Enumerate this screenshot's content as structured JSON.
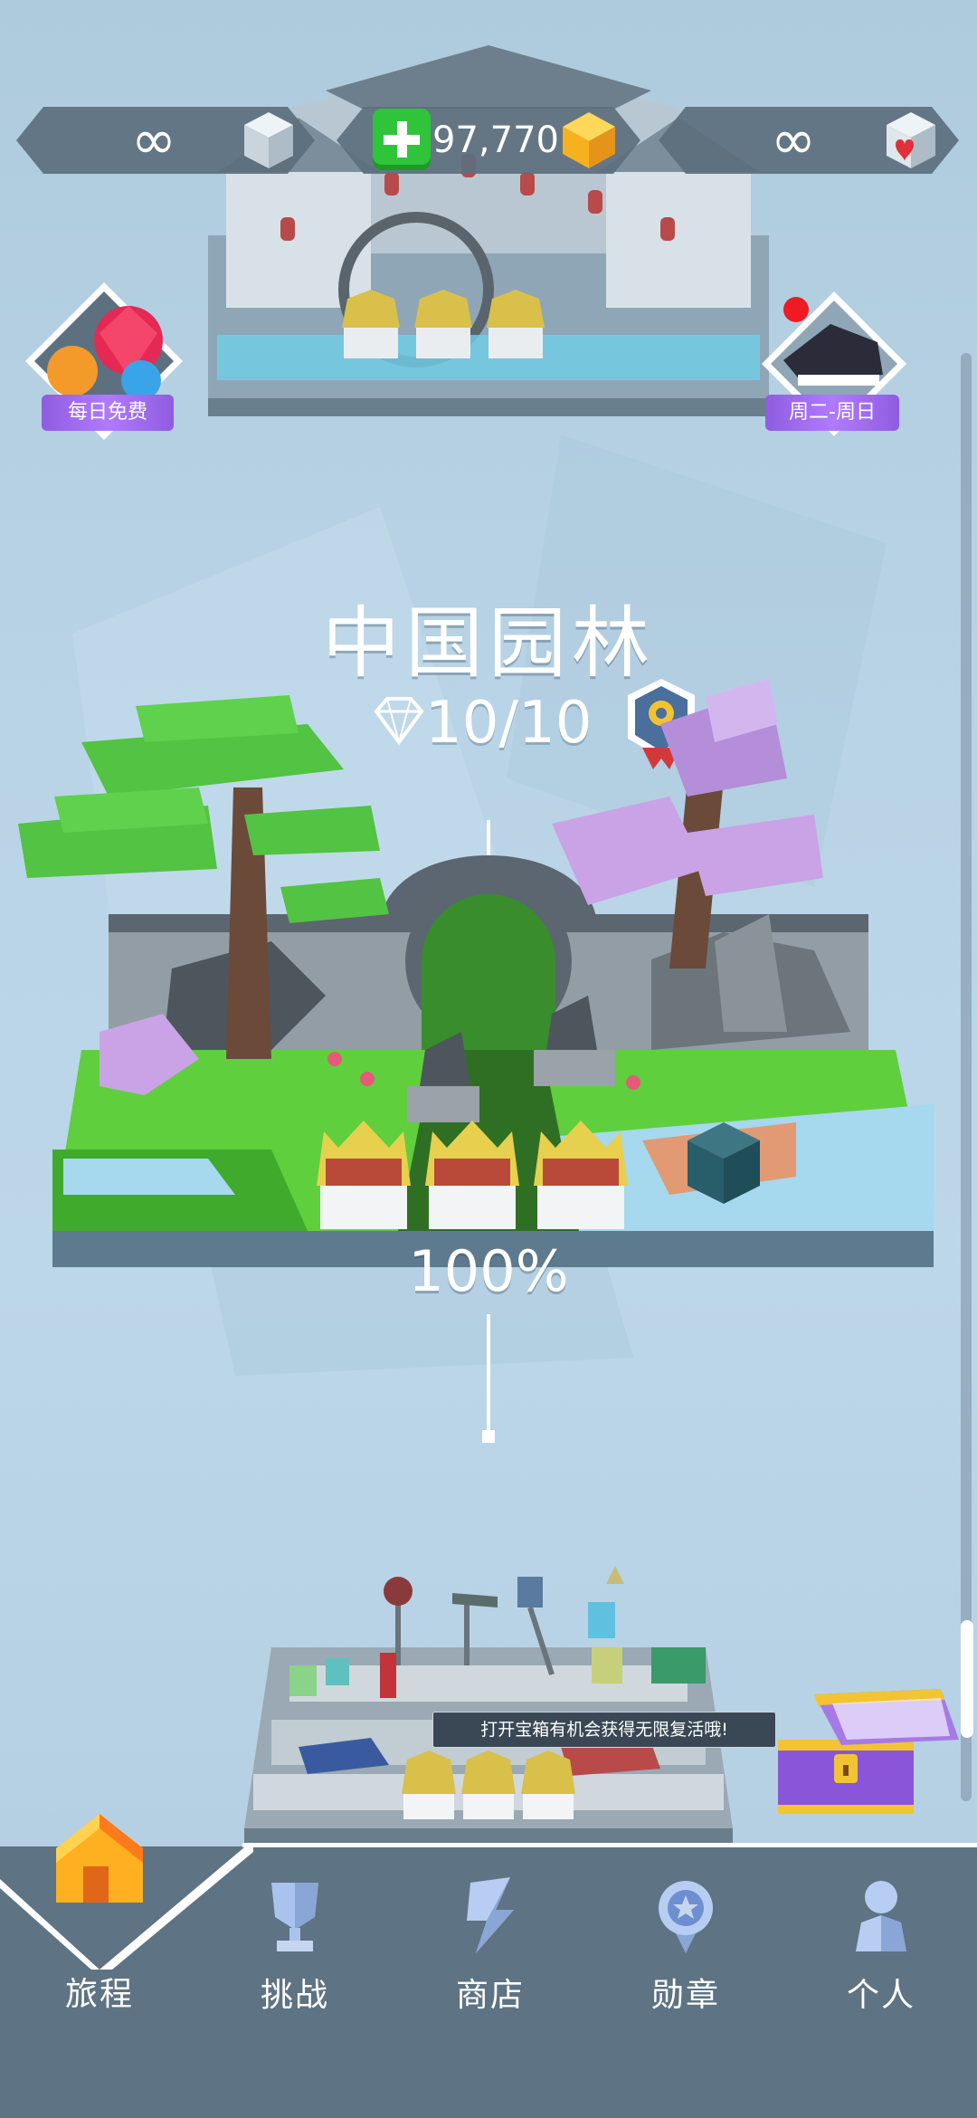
{
  "top_bar": {
    "lives": "∞",
    "diamond_balance": "97,770",
    "hearts": "∞"
  },
  "daily_free": {
    "label": "每日免费"
  },
  "weekend_event": {
    "label": "周二-周日"
  },
  "level": {
    "title": "中国园林",
    "diamonds": "10/10",
    "completion": "100%"
  },
  "chest_tip": "打开宝箱有机会获得无限复活哦!",
  "nav": {
    "items": [
      {
        "label": "旅程",
        "icon": "house-icon"
      },
      {
        "label": "挑战",
        "icon": "trophy-icon"
      },
      {
        "label": "商店",
        "icon": "shop-icon"
      },
      {
        "label": "勋章",
        "icon": "medal-icon"
      },
      {
        "label": "个人",
        "icon": "person-icon"
      }
    ]
  },
  "colors": {
    "accent_green": "#2fc43a",
    "nav_bg": "#5e7383",
    "badge_purple": "#a070f0",
    "grass": "#5fcf3e"
  }
}
